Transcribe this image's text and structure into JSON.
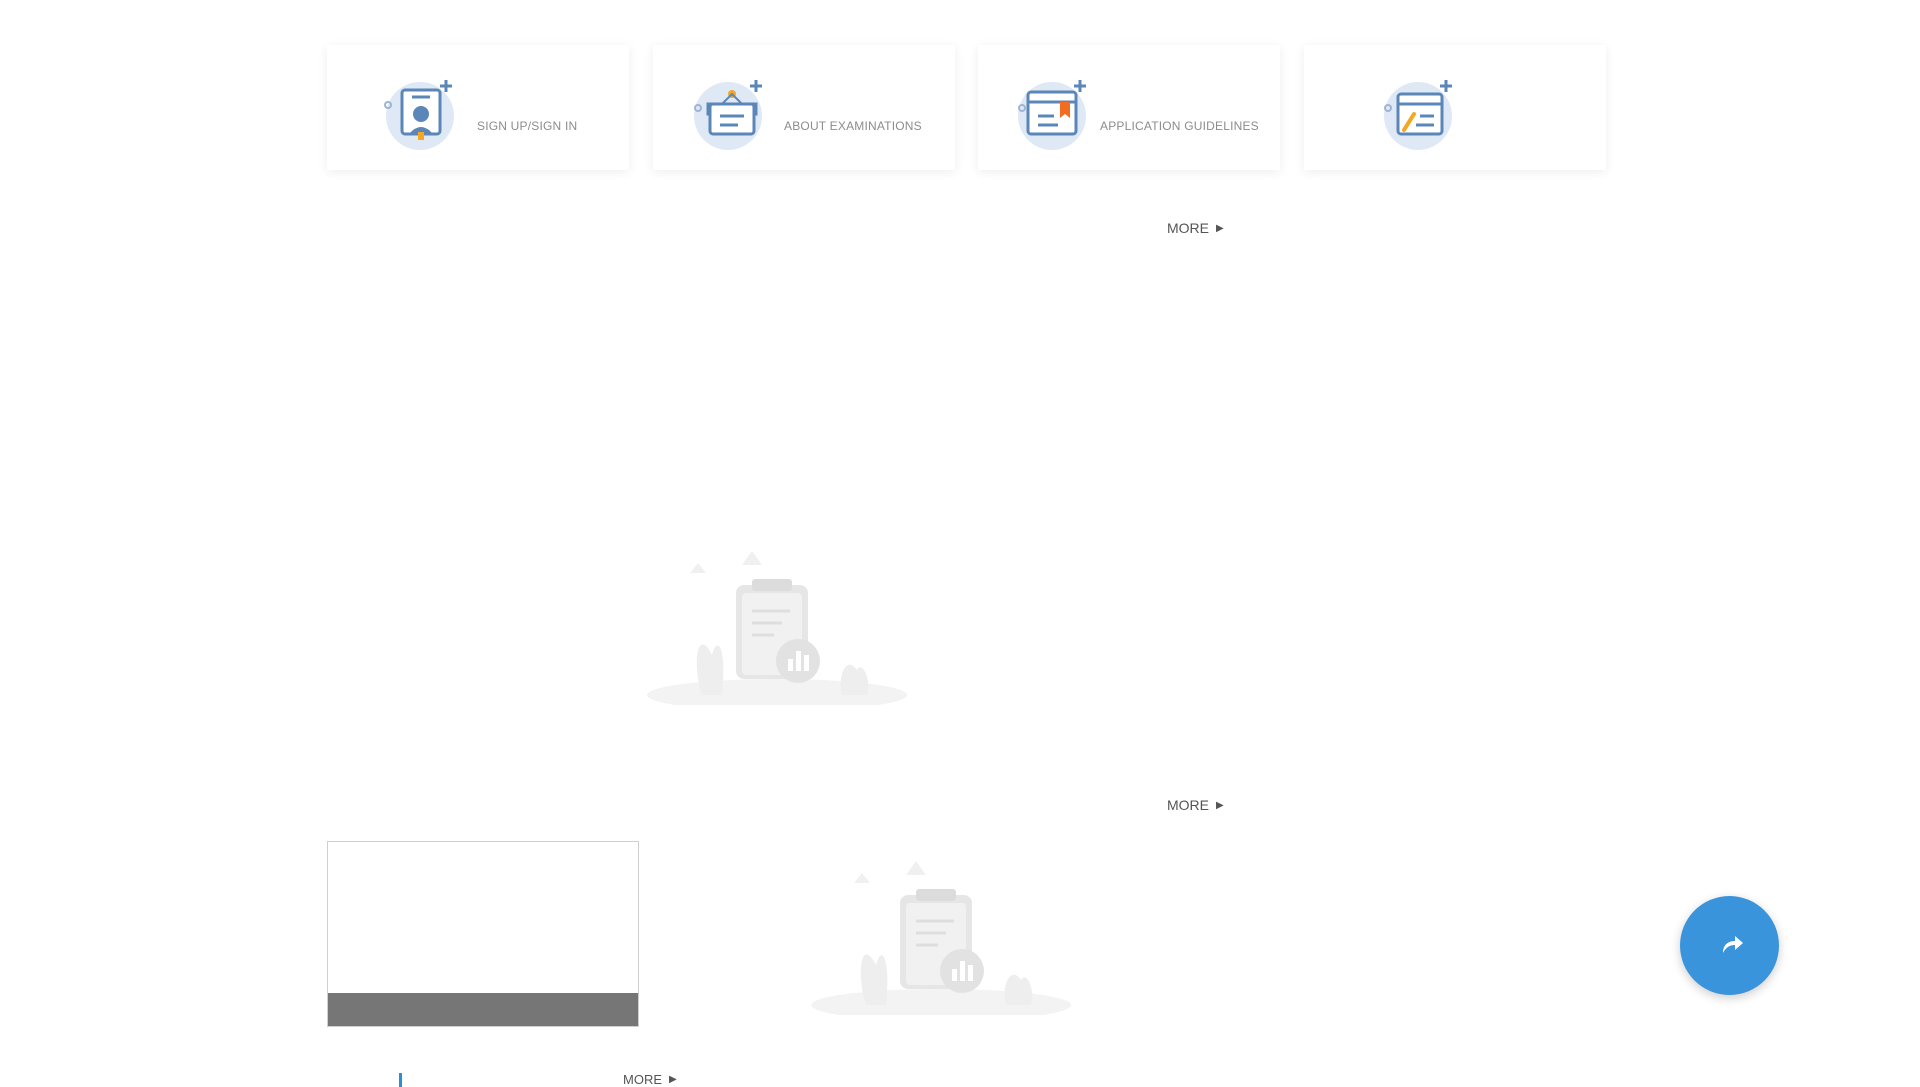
{
  "quick_links": [
    {
      "label": "SIGN UP/SIGN IN",
      "icon": "user-card-icon"
    },
    {
      "label": "ABOUT EXAMINATIONS",
      "icon": "exam-board-icon"
    },
    {
      "label": "APPLICATION GUIDELINES",
      "icon": "guidelines-bookmark-icon"
    },
    {
      "label": "",
      "icon": "edit-form-icon"
    }
  ],
  "sections": {
    "more_label_1": "MORE",
    "more_label_2": "MORE",
    "more_label_3": "MORE"
  },
  "empty_states": [
    {
      "icon": "empty-clipboard-icon"
    },
    {
      "icon": "empty-clipboard-icon"
    }
  ],
  "fab": {
    "icon": "share-icon"
  },
  "colors": {
    "accent": "#3a94dc",
    "icon_bg": "#dfe9f5",
    "icon_stroke": "#5b86b8",
    "icon_orange": "#f5a623"
  }
}
